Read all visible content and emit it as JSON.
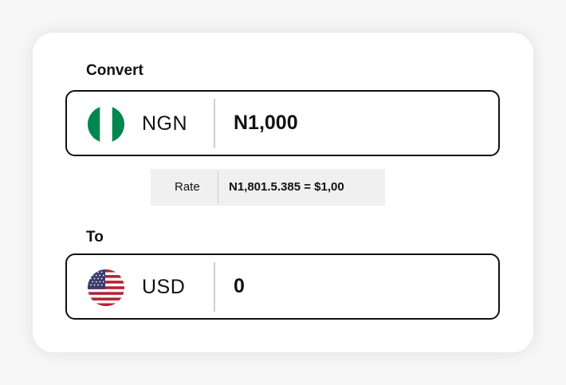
{
  "converter": {
    "from_label": "Convert",
    "to_label": "To",
    "from": {
      "currency_code": "NGN",
      "amount": "N1,000",
      "flag_icon": "nigeria-flag-icon",
      "flag_colors": [
        "#008751",
        "#ffffff",
        "#008751"
      ]
    },
    "rate": {
      "label": "Rate",
      "value": "N1,801.5.385 = $1,00"
    },
    "to": {
      "currency_code": "USD",
      "amount": "0",
      "flag_icon": "usa-flag-icon",
      "flag_colors": [
        "#b22234",
        "#ffffff",
        "#3c3b6e"
      ]
    }
  }
}
